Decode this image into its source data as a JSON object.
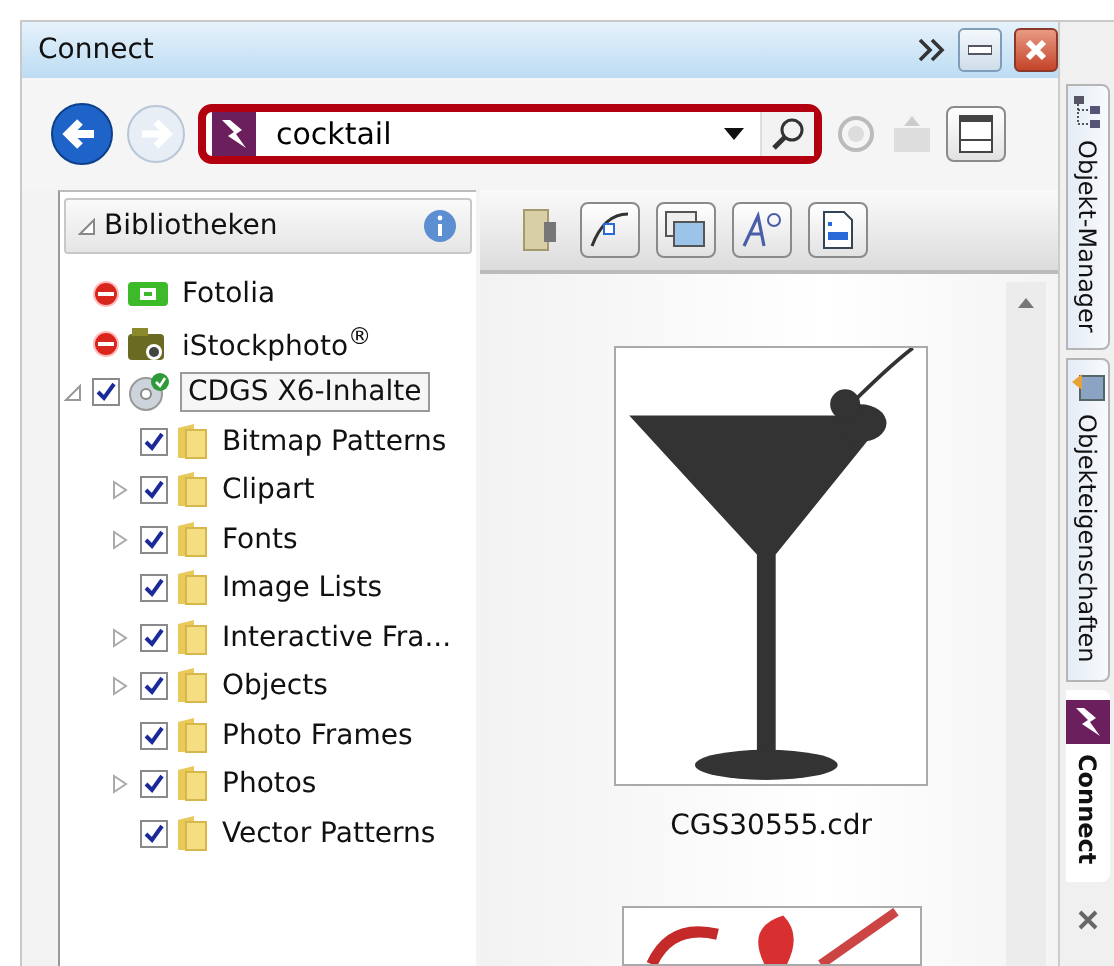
{
  "window": {
    "title": "Connect"
  },
  "search": {
    "value": "cocktail"
  },
  "tree": {
    "header": "Bibliotheken",
    "items": [
      {
        "kind": "badge",
        "label": "Fotolia",
        "selected": false
      },
      {
        "kind": "camera",
        "label": "iStockphoto$^{®}$",
        "selected": false
      },
      {
        "kind": "disc",
        "label": "CDGS X6-Inhalte",
        "checked": true,
        "selected": true,
        "expanded": true,
        "children": [
          {
            "kind": "folder",
            "label": "Bitmap Patterns",
            "checked": true,
            "selected": false
          },
          {
            "kind": "folder",
            "label": "Clipart",
            "checked": true,
            "selected": false,
            "expanded": false
          },
          {
            "kind": "folder",
            "label": "Fonts",
            "checked": true,
            "selected": false,
            "expanded": false
          },
          {
            "kind": "folder",
            "label": "Image Lists",
            "checked": true,
            "selected": false
          },
          {
            "kind": "folder",
            "label": "Interactive Fra...",
            "checked": true,
            "selected": false,
            "expanded": false
          },
          {
            "kind": "folder",
            "label": "Objects",
            "checked": true,
            "selected": false,
            "expanded": false
          },
          {
            "kind": "folder",
            "label": "Photo Frames",
            "checked": true,
            "selected": false
          },
          {
            "kind": "folder",
            "label": "Photos",
            "checked": true,
            "selected": false,
            "expanded": false
          },
          {
            "kind": "folder",
            "label": "Vector Patterns",
            "checked": true,
            "selected": false
          }
        ]
      }
    ]
  },
  "results": [
    {
      "kind": "cocktail",
      "filename": "CGS30555.cdr"
    },
    {
      "kind": "partial"
    }
  ],
  "side_tabs": [
    {
      "kind": "tree",
      "label": "Objekt-Manager",
      "selected": false
    },
    {
      "kind": "props",
      "label": "Objekteigenschaften",
      "selected": false
    },
    {
      "kind": "connect",
      "label": "Connect",
      "selected": true
    }
  ]
}
